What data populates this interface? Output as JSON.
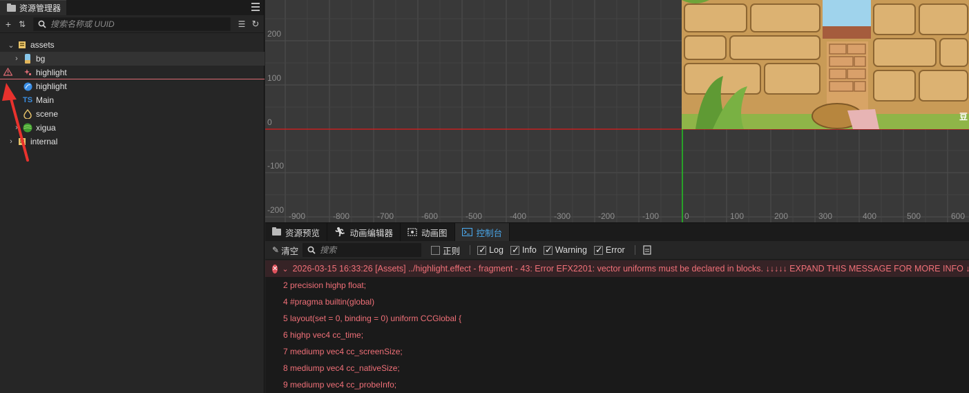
{
  "asset_panel": {
    "title": "资源管理器",
    "search_placeholder": "搜索名称或 UUID",
    "tree": [
      {
        "label": "assets",
        "icon": "folder-icon"
      },
      {
        "label": "bg",
        "icon": "image-icon"
      },
      {
        "label": "highlight",
        "icon": "effect-icon",
        "warning": true
      },
      {
        "label": "highlight",
        "icon": "material-icon"
      },
      {
        "label": "Main",
        "icon": "typescript-icon",
        "icon_text": "TS"
      },
      {
        "label": "scene",
        "icon": "scene-icon"
      },
      {
        "label": "xigua",
        "icon": "sprite-icon"
      },
      {
        "label": "internal",
        "icon": "folder-icon"
      }
    ]
  },
  "scene_view": {
    "y_ticks": [
      "200",
      "100",
      "0",
      "-100",
      "-200"
    ],
    "x_ticks": [
      "-900",
      "-800",
      "-700",
      "-600",
      "-500",
      "-400",
      "-300",
      "-200",
      "-100",
      "0",
      "100",
      "200",
      "300",
      "400",
      "500",
      "600"
    ],
    "corner_char": "豆",
    "colors": {
      "grid": "#4e4e4e",
      "x_axis": "#c52121",
      "y_axis": "#22c422",
      "background": "#393939"
    }
  },
  "bottom_tabs": [
    {
      "label": "资源预览",
      "icon": "folder-icon"
    },
    {
      "label": "动画编辑器",
      "icon": "running-icon"
    },
    {
      "label": "动画图",
      "icon": "graph-icon"
    },
    {
      "label": "控制台",
      "icon": "terminal-icon",
      "active": true
    }
  ],
  "console": {
    "clear_label": "清空",
    "filter_placeholder": "搜索",
    "filters": [
      {
        "label": "正则",
        "checked": false
      },
      {
        "label": "Log",
        "checked": true
      },
      {
        "label": "Info",
        "checked": true
      },
      {
        "label": "Warning",
        "checked": true
      },
      {
        "label": "Error",
        "checked": true
      }
    ],
    "error_header": "2026-03-15 16:33:26 [Assets] ../highlight.effect - fragment - 43: Error EFX2201: vector uniforms must be declared in blocks. ↓↓↓↓↓ EXPAND THIS MESSAGE FOR MORE INFO ↓↓↓↓↓",
    "lines": [
      "2 precision highp float;",
      "4 #pragma builtin(global)",
      "5 layout(set = 0, binding = 0) uniform CCGlobal {",
      "6 highp vec4 cc_time;",
      "7 mediump vec4 cc_screenSize;",
      "8 mediump vec4 cc_nativeSize;",
      "9 mediump vec4 cc_probeInfo;"
    ],
    "error_color": "#f07078"
  }
}
